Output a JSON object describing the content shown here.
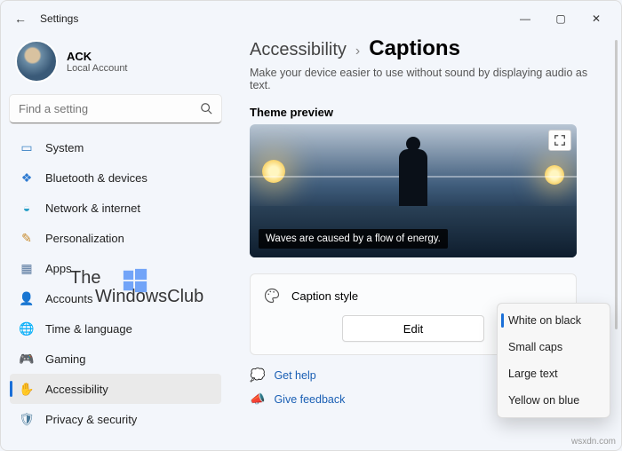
{
  "window": {
    "title": "Settings"
  },
  "user": {
    "name": "ACK",
    "type": "Local Account"
  },
  "search": {
    "placeholder": "Find a setting"
  },
  "nav": {
    "items": [
      {
        "label": "System"
      },
      {
        "label": "Bluetooth & devices"
      },
      {
        "label": "Network & internet"
      },
      {
        "label": "Personalization"
      },
      {
        "label": "Apps"
      },
      {
        "label": "Accounts"
      },
      {
        "label": "Time & language"
      },
      {
        "label": "Gaming"
      },
      {
        "label": "Accessibility"
      },
      {
        "label": "Privacy & security"
      }
    ]
  },
  "breadcrumb": {
    "parent": "Accessibility",
    "sep": "›",
    "current": "Captions"
  },
  "subtitle": "Make your device easier to use without sound by displaying audio as text.",
  "preview": {
    "label": "Theme preview",
    "caption_text": "Waves are caused by a flow of energy."
  },
  "card": {
    "title": "Caption style",
    "edit_label": "Edit"
  },
  "dropdown": {
    "items": [
      {
        "label": "White on black"
      },
      {
        "label": "Small caps"
      },
      {
        "label": "Large text"
      },
      {
        "label": "Yellow on blue"
      }
    ]
  },
  "links": {
    "help": "Get help",
    "feedback": "Give feedback"
  },
  "watermark": {
    "line1": "The",
    "line2": "WindowsClub"
  },
  "source": "wsxdn.com"
}
